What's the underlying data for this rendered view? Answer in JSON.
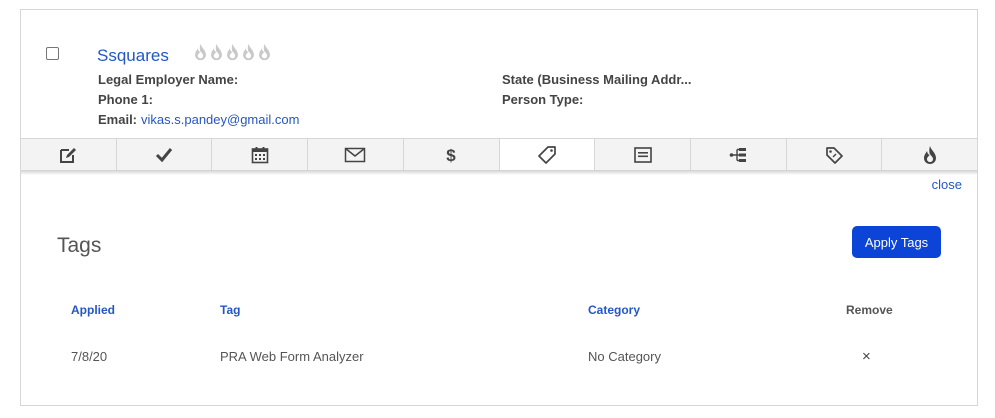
{
  "contact": {
    "name": "Ssquares",
    "rating_icons": [
      "flame-icon",
      "flame-icon",
      "flame-icon",
      "flame-icon",
      "flame-icon"
    ],
    "fields": {
      "legal_employer_label": "Legal Employer Name:",
      "legal_employer_value": "",
      "phone_label": "Phone 1:",
      "phone_value": "",
      "email_label": "Email:",
      "email_value": "vikas.s.pandey@gmail.com",
      "state_label": "State (Business Mailing Addr...",
      "state_value": "",
      "person_type_label": "Person Type:",
      "person_type_value": ""
    }
  },
  "toolbar": {
    "tabs": [
      {
        "icon": "edit-icon"
      },
      {
        "icon": "checkmark-icon"
      },
      {
        "icon": "calendar-icon"
      },
      {
        "icon": "envelope-icon"
      },
      {
        "icon": "dollar-icon"
      },
      {
        "icon": "tag-icon",
        "active": true
      },
      {
        "icon": "form-icon"
      },
      {
        "icon": "hierarchy-icon"
      },
      {
        "icon": "tags-icon"
      },
      {
        "icon": "flame-icon"
      }
    ]
  },
  "panel": {
    "close_label": "close",
    "title": "Tags",
    "apply_button": "Apply Tags",
    "columns": {
      "applied": "Applied",
      "tag": "Tag",
      "category": "Category",
      "remove": "Remove"
    },
    "rows": [
      {
        "applied": "7/8/20",
        "tag": "PRA Web Form Analyzer",
        "category": "No Category",
        "remove": "×"
      }
    ]
  },
  "colors": {
    "link": "#2556c5",
    "button": "#0b44d6",
    "toolbar_bg": "#f3f3f3",
    "flame": "#c8c8c8"
  }
}
